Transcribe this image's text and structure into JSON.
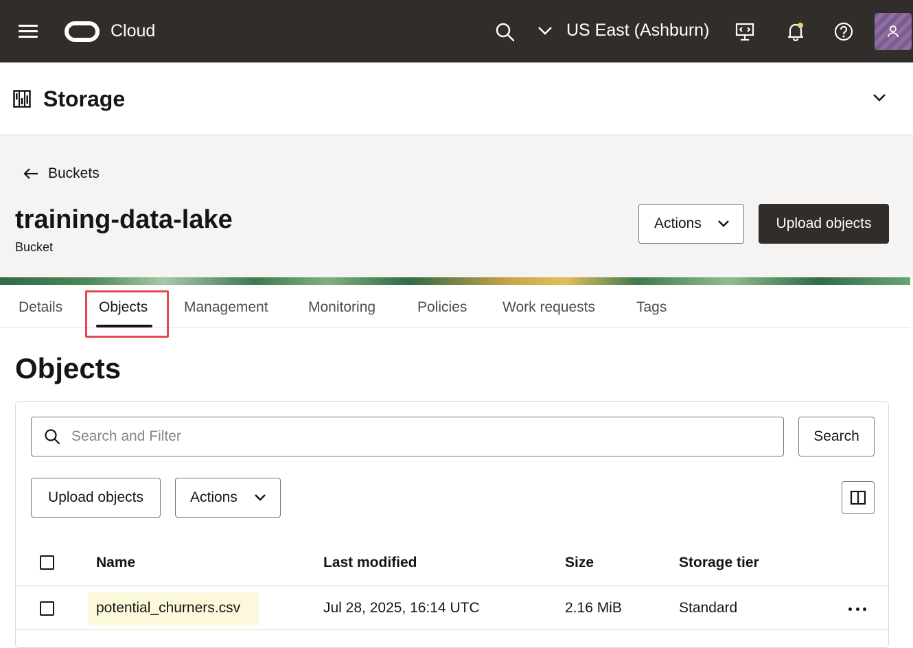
{
  "topbar": {
    "brand": "Cloud",
    "region": "US East (Ashburn)",
    "icons": [
      "menu-icon",
      "oracle-logo-icon",
      "search-icon",
      "chevron-down-icon",
      "developer-tools-icon",
      "notification-bell-icon",
      "help-icon",
      "user-icon"
    ]
  },
  "service": {
    "title": "Storage"
  },
  "page": {
    "back_label": "Buckets",
    "bucket_name": "training-data-lake",
    "bucket_type": "Bucket",
    "actions_label": "Actions",
    "upload_label": "Upload objects"
  },
  "tabs": [
    "Details",
    "Objects",
    "Management",
    "Monitoring",
    "Policies",
    "Work requests",
    "Tags"
  ],
  "active_tab": "Objects",
  "objects": {
    "title": "Objects",
    "search_placeholder": "Search and Filter",
    "search_button": "Search",
    "upload_label": "Upload objects",
    "actions_label": "Actions",
    "columns": [
      "Name",
      "Last modified",
      "Size",
      "Storage tier"
    ],
    "rows": [
      {
        "name": "potential_churners.csv",
        "last_modified": "Jul 28, 2025, 16:14 UTC",
        "size": "2.16 MiB",
        "tier": "Standard"
      }
    ]
  },
  "colors": {
    "topbar": "#312d2a",
    "primary_button": "#312d2a",
    "highlight": "#e5484d",
    "row_highlight": "#fbf8dc"
  }
}
